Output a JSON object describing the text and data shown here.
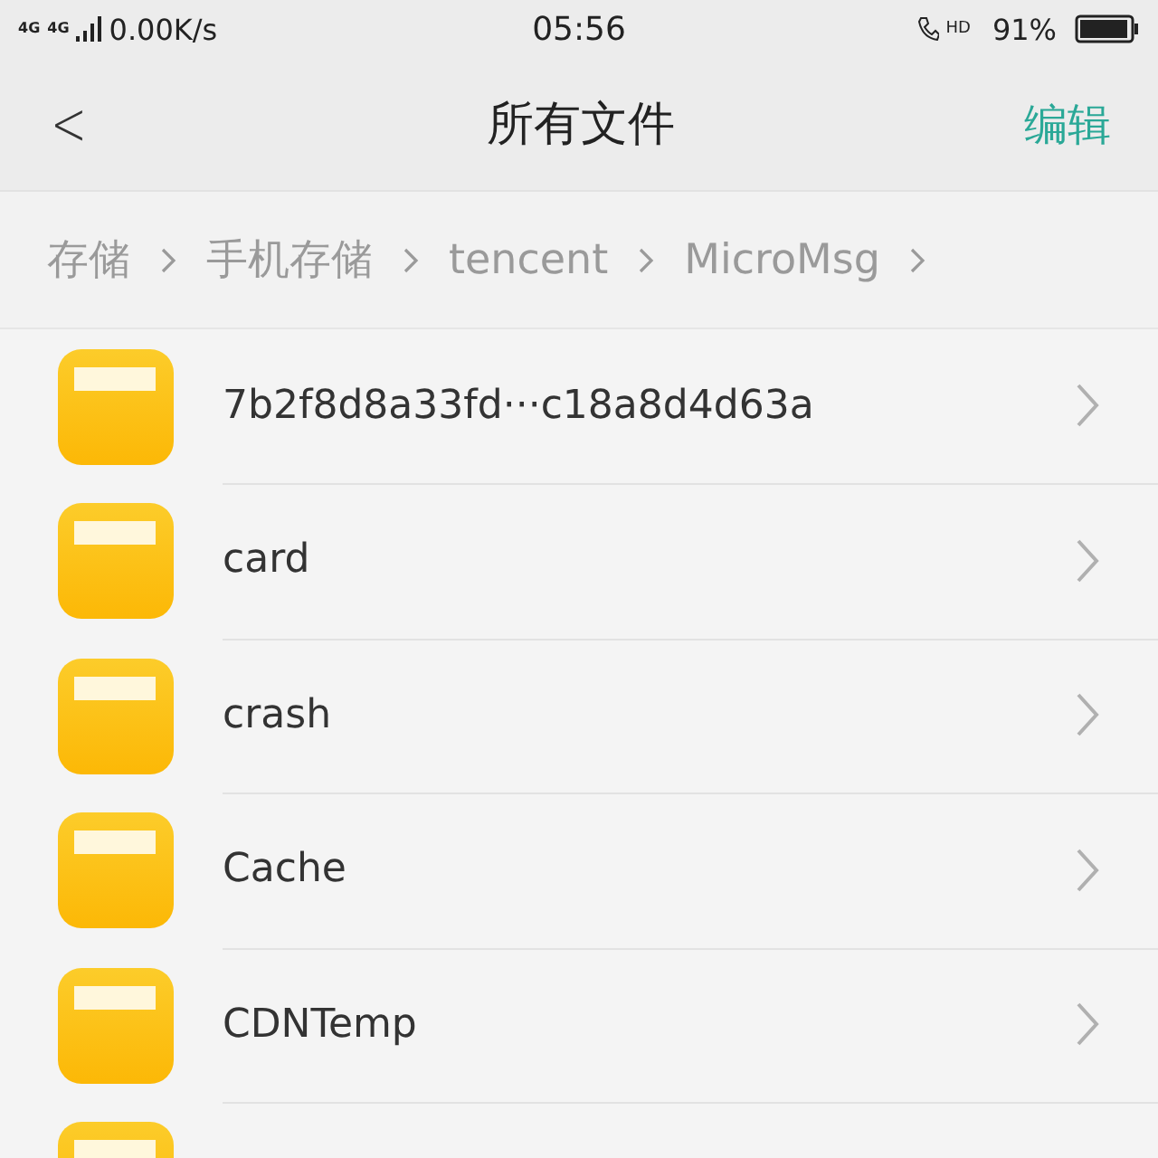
{
  "status_bar": {
    "network_1": "4G",
    "network_2": "4G",
    "speed": "0.00K/s",
    "time": "05:56",
    "call_badge": "HD",
    "battery": "91%"
  },
  "header": {
    "back": "<",
    "title": "所有文件",
    "action": "编辑"
  },
  "breadcrumb": [
    "存储",
    "手机存储",
    "tencent",
    "MicroMsg"
  ],
  "files": [
    {
      "name": "7b2f8d8a33fd···c18a8d4d63a"
    },
    {
      "name": "card"
    },
    {
      "name": "crash"
    },
    {
      "name": "Cache"
    },
    {
      "name": "CDNTemp"
    }
  ]
}
